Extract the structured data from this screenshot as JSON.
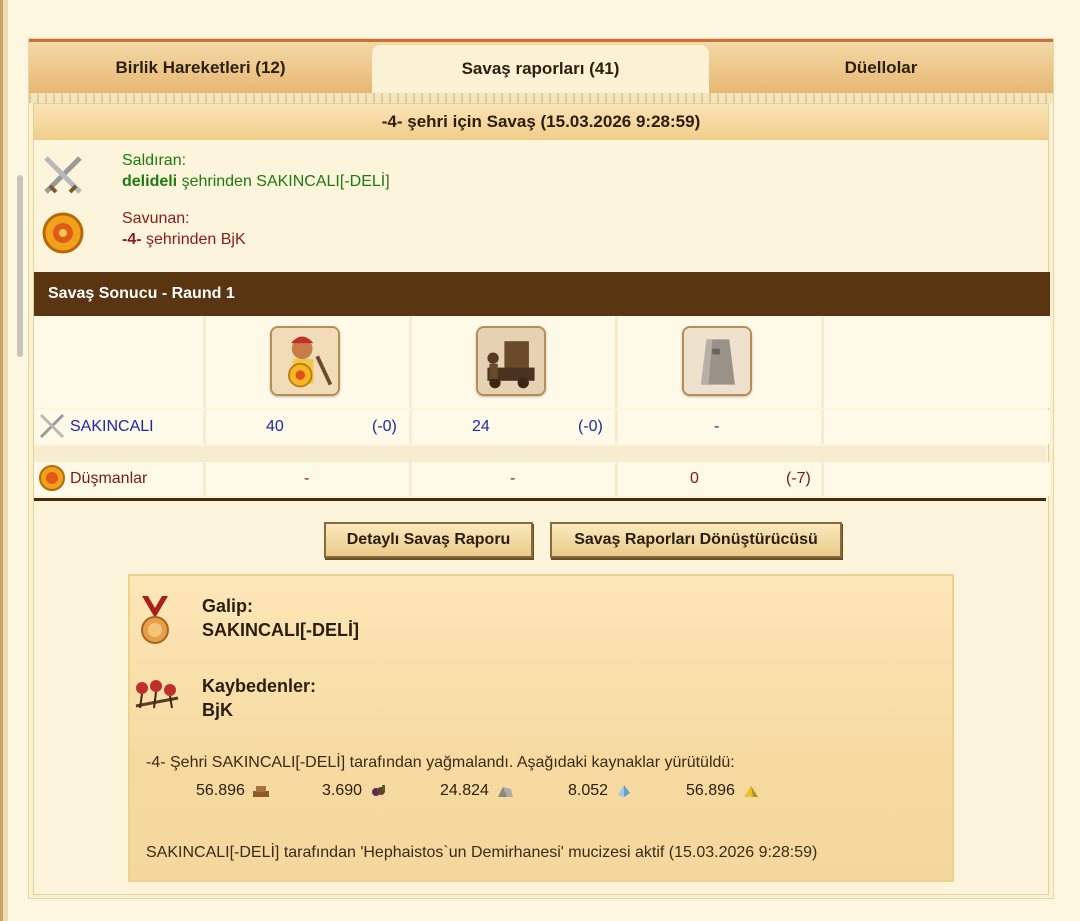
{
  "tabs": [
    {
      "label": "Birlik Hareketleri (12)"
    },
    {
      "label": "Savaş raporları (41)"
    },
    {
      "label": "Düellolar"
    }
  ],
  "report": {
    "title": "-4- şehri için Savaş (15.03.2026 9:28:59)",
    "attacker": {
      "label": "Saldıran:",
      "city": "delideli",
      "rest": " şehrinden SAKINCALI[-DELİ]"
    },
    "defender": {
      "label": "Savunan:",
      "city": "-4-",
      "rest": " şehrinden BjK"
    }
  },
  "result": {
    "header": "Savaş Sonucu - Raund 1",
    "units": [
      "hoplite-unit-icon",
      "catapult-unit-icon",
      "wall-unit-icon"
    ],
    "attacker_row": {
      "name": "SAKINCALI",
      "cells": [
        {
          "count": "40",
          "loss": "(-0)"
        },
        {
          "count": "24",
          "loss": "(-0)"
        },
        {
          "count": "-",
          "loss": ""
        }
      ]
    },
    "enemy_row": {
      "name": "Düşmanlar",
      "cells": [
        {
          "count": "-",
          "loss": ""
        },
        {
          "count": "-",
          "loss": ""
        },
        {
          "count": "0",
          "loss": "(-7)"
        }
      ]
    }
  },
  "buttons": {
    "detailed": "Detaylı Savaş Raporu",
    "converter": "Savaş Raporları Dönüştürücüsü"
  },
  "summary": {
    "winner_label": "Galip:",
    "winner": "SAKINCALI[-DELİ]",
    "losers_label": "Kaybedenler:",
    "losers": "BjK",
    "plunder_text": "-4- Şehri SAKINCALI[-DELİ] tarafından yağmalandı. Aşağıdaki kaynaklar yürütüldü:",
    "resources": [
      {
        "value": "56.896",
        "icon": "wood-icon"
      },
      {
        "value": "3.690",
        "icon": "wine-icon"
      },
      {
        "value": "24.824",
        "icon": "marble-icon"
      },
      {
        "value": "8.052",
        "icon": "crystal-icon"
      },
      {
        "value": "56.896",
        "icon": "sulfur-icon"
      }
    ],
    "wonder_text": "SAKINCALI[-DELİ] tarafından 'Hephaistos`un Demirhanesi' mucizesi aktif (15.03.2026 9:28:59)"
  },
  "colors": {
    "attacker": "#1c7a10",
    "defender": "#8a1c1c",
    "result_bar": "#5a3512"
  }
}
